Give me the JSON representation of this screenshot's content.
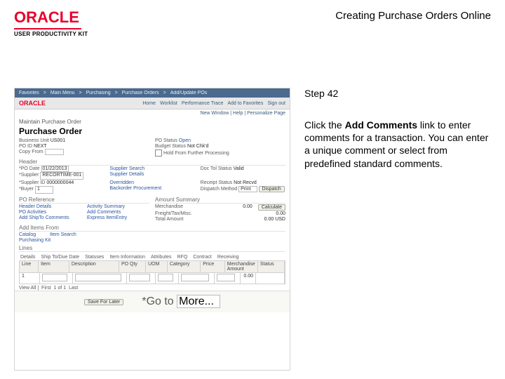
{
  "brand": {
    "name": "ORACLE",
    "kit": "USER PRODUCTIVITY KIT"
  },
  "page_title": "Creating Purchase Orders Online",
  "step_label": "Step 42",
  "instruction": {
    "pre": "Click the ",
    "bold": "Add Comments",
    "post": " link to enter comments for a transaction. You can enter a unique comment or select from predefined standard comments."
  },
  "ss": {
    "nav": [
      "Favorites",
      "Main Menu",
      "Purchasing",
      "Purchase Orders",
      "Add/Update POs"
    ],
    "nav_right": [
      "Home",
      "Worklist",
      "Performance Trace",
      "Add to Favorites",
      "Sign out"
    ],
    "breadcrumb": "New Window | Help | Personalize Page",
    "heading": "Maintain Purchase Order",
    "title": "Purchase Order",
    "top": {
      "l1a": "Business Unit",
      "l1av": "US001",
      "l2a": "PO ID",
      "l2av": "NEXT",
      "r1a": "PO Status",
      "r1av": "Open",
      "r2a": "Budget Status",
      "r2av": "Not Chk'd",
      "l3a": "Copy From",
      "r3a": "Hold From Further Processing"
    },
    "header_sec": "Header",
    "header_fields": {
      "po_date_l": "*PO Date",
      "po_date_v": "01/22/2013",
      "supplier_l": "*Supplier",
      "supplier_v": "RECORTIME-001",
      "supplier_id_l": "*Supplier ID",
      "supplier_id_v": "0000000044",
      "buyer_l": "*Buyer",
      "buyer_v": "1",
      "supplier_sr_l": "Supplier Search",
      "supplier_det_l": "Supplier Details",
      "overridden_l": "Overridden",
      "backorder_l": "Backorder Procurement",
      "doc_l": "Doc Tol Status",
      "doc_v": "Valid",
      "rcpt_l": "Receipt Status",
      "rcpt_v": "Not Recvd",
      "disp_l": "Dispatch Method",
      "disp_v": "Print",
      "dispatch_btn": "Dispatch"
    },
    "links_sec": "PO Reference",
    "links": {
      "hd_l": "Header Details",
      "acn_l": "Activity Summary",
      "adp_l": "Add ShipTo Comments",
      "pod_l": "PO Activities",
      "adc_l": "Add Comments",
      "ertd_l": "Express ItemEntry"
    },
    "amount_sec": "Amount Summary",
    "amount": {
      "merch_l": "Merchandise",
      "merch_v": "0.00",
      "freight_l": "Freight/Tax/Misc.",
      "freight_v": "0.00",
      "total_l": "Total Amount",
      "total_v": "0.00 USD",
      "calc_btn": "Calculate"
    },
    "additems_sec": "Add Items From",
    "additems": {
      "cat_l": "Catalog",
      "purkits_l": "Purchasing Kit",
      "is_l": "Item Search"
    },
    "lines_sec": "Lines",
    "tabs2": [
      "Details",
      "Ship To/Due Date",
      "Statuses",
      "Item Information",
      "Attributes",
      "RFQ",
      "Contract",
      "Receiving"
    ],
    "grid_hdr": [
      "Line",
      "Item",
      "Description",
      "PO Qty",
      "UOM",
      "Category",
      "Price",
      "Merchandise Amount",
      "Status"
    ],
    "grid_row": [
      "1",
      "",
      "",
      "",
      "",
      "",
      "",
      "0.00",
      ""
    ],
    "row_count": "1",
    "foot": {
      "save_btn": "Save For Later",
      "go_l": "*Go to",
      "go_v": "More..."
    }
  }
}
